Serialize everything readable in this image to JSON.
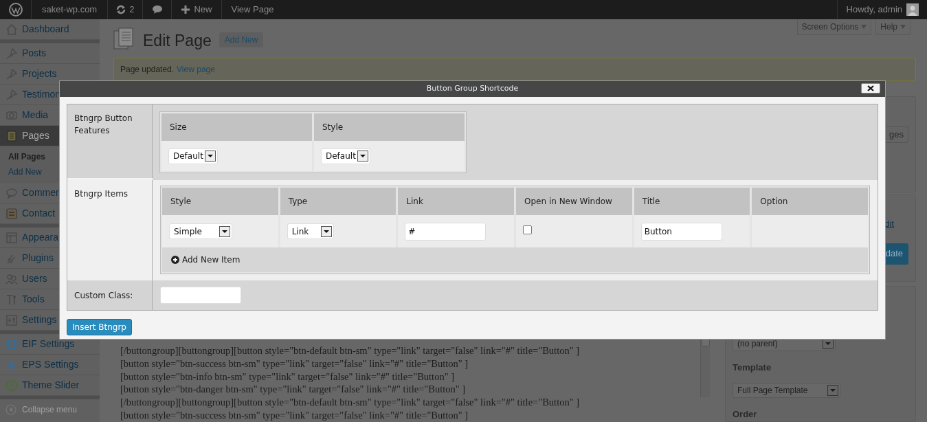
{
  "admin_bar": {
    "site": "saket-wp.com",
    "updates": "2",
    "new": "New",
    "view": "View Page",
    "greeting": "Howdy, admin"
  },
  "sidebar": {
    "items": [
      {
        "label": "Dashboard",
        "selected": false,
        "gap_after": true
      },
      {
        "label": "Posts",
        "selected": false
      },
      {
        "label": "Projects",
        "selected": false
      },
      {
        "label": "Testimon",
        "selected": false
      },
      {
        "label": "Media",
        "selected": false
      },
      {
        "label": "Pages",
        "selected": true,
        "children": [
          {
            "label": "All Pages",
            "selected": true
          },
          {
            "label": "Add New",
            "selected": false
          }
        ]
      },
      {
        "label": "Commen",
        "selected": false
      },
      {
        "label": "Contact",
        "selected": false,
        "gap_after": true
      },
      {
        "label": "Appeara",
        "selected": false
      },
      {
        "label": "Plugins",
        "selected": false
      },
      {
        "label": "Users",
        "selected": false
      },
      {
        "label": "Tools",
        "selected": false
      },
      {
        "label": "Settings",
        "selected": false,
        "gap_after": true
      },
      {
        "label": "EIF Settings",
        "selected": false
      },
      {
        "label": "EPS Settings",
        "selected": false
      },
      {
        "label": "Theme Slider",
        "selected": false,
        "gap_after": true
      }
    ],
    "collapse": "Collapse menu"
  },
  "header": {
    "title": "Edit Page",
    "add_new": "Add New",
    "screen_options": "Screen Options",
    "help": "Help"
  },
  "notice": {
    "text": "Page updated.",
    "link": "View page"
  },
  "editor": {
    "lines": [
      "[/buttongroup][buttongroup][button style=\"btn-default btn-sm\" type=\"link\" target=\"false\" link=\"#\" title=\"Button\" ]",
      "[button style=\"btn-success btn-sm\" type=\"link\" target=\"false\" link=\"#\" title=\"Button\" ]",
      "[button style=\"btn-info btn-sm\" type=\"link\" target=\"false\" link=\"#\" title=\"Button\" ]",
      "[button style=\"btn-danger btn-sm\" type=\"link\" target=\"false\" link=\"#\" title=\"Button\" ]",
      "[/buttongroup][buttongroup][button style=\"btn-default btn-sm\" type=\"link\" target=\"false\" link=\"#\" title=\"Button\" ]",
      "[button style=\"btn-success btn-sm\" type=\"link\" target=\"false\" link=\"#\" title=\"Button\" ]"
    ]
  },
  "right_column": {
    "pages_button": "ges",
    "edit_link": "dit",
    "update_button": "date",
    "parent": "(no parent)",
    "template_label": "Template",
    "template": "Full Page Template",
    "order_label": "Order"
  },
  "modal": {
    "title": "Button Group Shortcode",
    "sections": [
      {
        "kind": "features",
        "label": "Btngrp Button Features",
        "columns": [
          {
            "header": "Size",
            "value": "Default"
          },
          {
            "header": "Style",
            "value": "Default"
          }
        ]
      },
      {
        "kind": "items",
        "label": "Btngrp Items",
        "columns": [
          "Style",
          "Type",
          "Link",
          "Open in New Window",
          "Title",
          "Option"
        ],
        "rows": [
          {
            "style": "Simple",
            "type": "Link",
            "link": "#",
            "new_window": false,
            "title": "Button"
          }
        ],
        "add_item": "Add New Item"
      },
      {
        "kind": "text",
        "label": "Custom Class:"
      }
    ],
    "insert_button": "Insert Btngrp"
  }
}
